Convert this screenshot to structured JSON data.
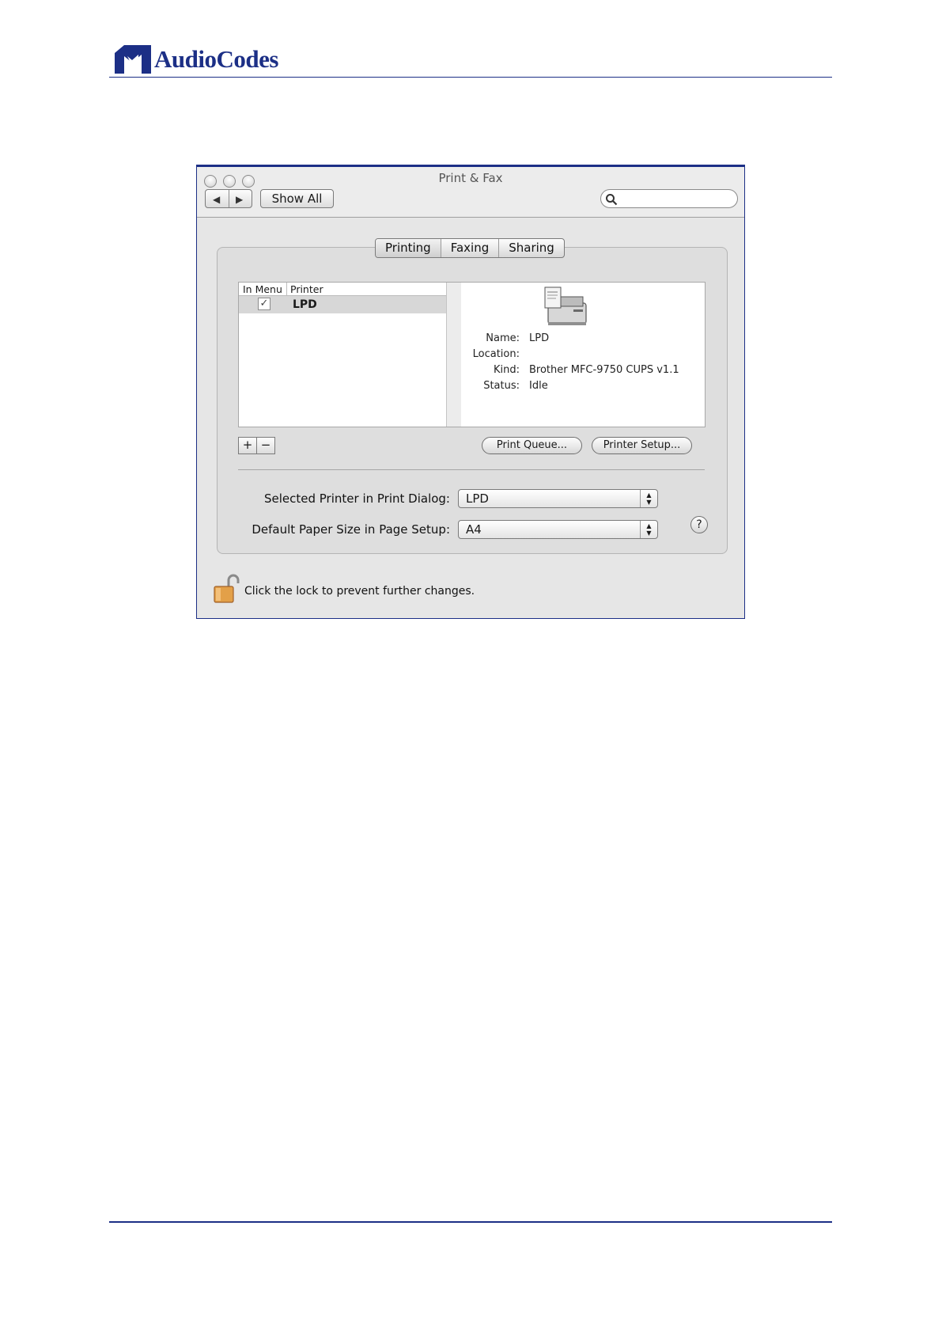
{
  "page": {
    "logo_text": "AudioCodes"
  },
  "window": {
    "title": "Print & Fax",
    "nav_back_icon": "back-arrow-icon",
    "nav_forward_icon": "forward-arrow-icon",
    "show_all_label": "Show All",
    "search_placeholder": "",
    "tabs": [
      {
        "label": "Printing"
      },
      {
        "label": "Faxing"
      },
      {
        "label": "Sharing"
      }
    ],
    "printer_list": {
      "col_in_menu": "In Menu",
      "col_printer": "Printer",
      "rows": [
        {
          "in_menu": "✓",
          "name": "LPD"
        }
      ]
    },
    "details": {
      "name_label": "Name:",
      "name_value": "LPD",
      "location_label": "Location:",
      "location_value": "",
      "kind_label": "Kind:",
      "kind_value": "Brother MFC-9750 CUPS v1.1",
      "status_label": "Status:",
      "status_value": "Idle"
    },
    "add_label": "+",
    "remove_label": "−",
    "print_queue_label": "Print Queue...",
    "printer_setup_label": "Printer Setup...",
    "selected_printer_label": "Selected Printer in Print Dialog:",
    "selected_printer_value": "LPD",
    "paper_size_label": "Default Paper Size in Page Setup:",
    "paper_size_value": "A4",
    "help_label": "?",
    "lock_text": "Click the lock to prevent further changes."
  }
}
